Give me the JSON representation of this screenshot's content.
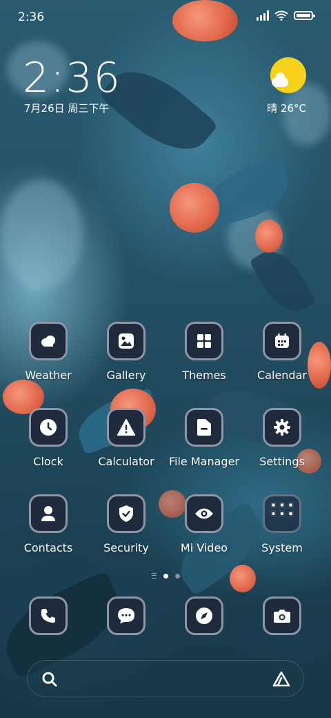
{
  "status_bar": {
    "time": "2:36",
    "battery_level": 1.0
  },
  "clock_widget": {
    "time": "2:36",
    "date": "7月26日 周三下午",
    "weather": "晴 26°C",
    "weather_icon": "sun-cloud-icon"
  },
  "apps": [
    {
      "label": "Weather",
      "icon": "weather-icon"
    },
    {
      "label": "Gallery",
      "icon": "gallery-icon"
    },
    {
      "label": "Themes",
      "icon": "themes-icon"
    },
    {
      "label": "Calendar",
      "icon": "calendar-icon"
    },
    {
      "label": "Clock",
      "icon": "clock-icon"
    },
    {
      "label": "Calculator",
      "icon": "warning-icon"
    },
    {
      "label": "File Manager",
      "icon": "folder-icon"
    },
    {
      "label": "Settings",
      "icon": "gear-icon"
    },
    {
      "label": "Contacts",
      "icon": "person-icon"
    },
    {
      "label": "Security",
      "icon": "shield-icon"
    },
    {
      "label": "Mi Video",
      "icon": "eye-icon"
    },
    {
      "label": "System",
      "icon": "folder-grid-icon"
    }
  ],
  "dock": [
    {
      "icon": "phone-icon"
    },
    {
      "icon": "message-icon"
    },
    {
      "icon": "compass-icon"
    },
    {
      "icon": "camera-icon"
    }
  ],
  "page_indicator": {
    "pages": 2,
    "current": 1
  },
  "colors": {
    "icon_bg": "#1f2a3d",
    "icon_border": "#8f97a6",
    "sun": "#f7d21a"
  }
}
